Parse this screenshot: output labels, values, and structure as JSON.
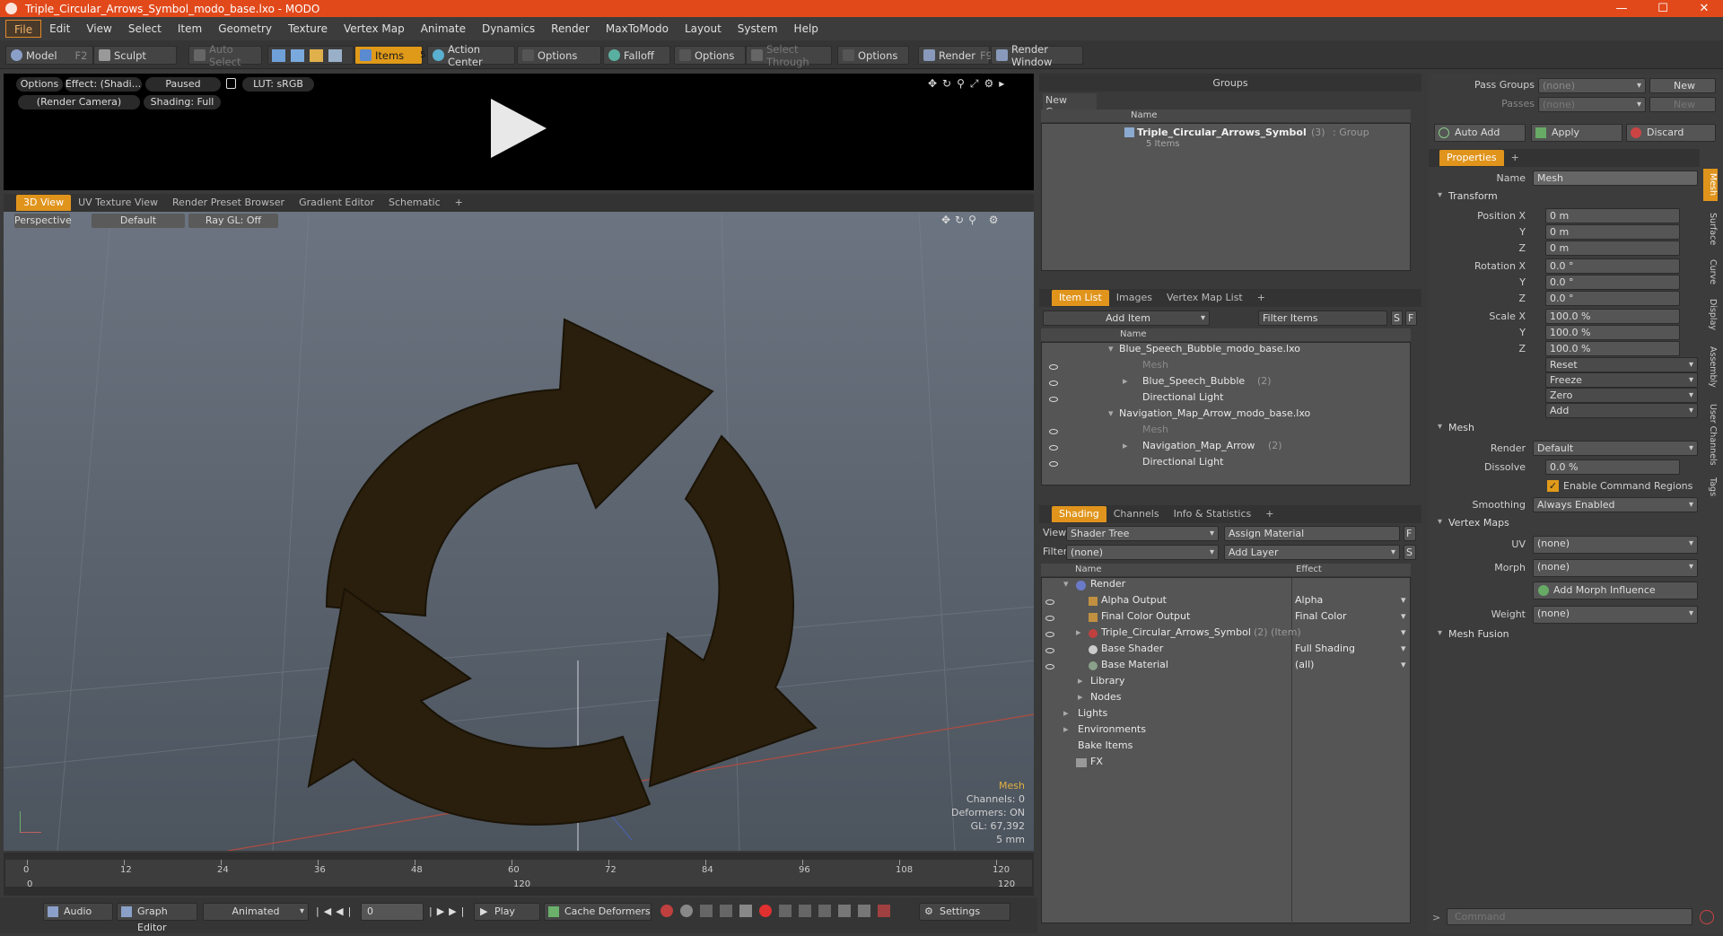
{
  "window": {
    "title": "Triple_Circular_Arrows_Symbol_modo_base.lxo - MODO"
  },
  "menu": [
    "File",
    "Edit",
    "View",
    "Select",
    "Item",
    "Geometry",
    "Texture",
    "Vertex Map",
    "Animate",
    "Dynamics",
    "Render",
    "MaxToModo",
    "Layout",
    "System",
    "Help"
  ],
  "toolbar": {
    "model": "Model",
    "model_key": "F2",
    "sculpt": "Sculpt",
    "auto_select": "Auto Select",
    "items": "Items",
    "items_key": "5",
    "action_center": "Action Center",
    "options1": "Options",
    "falloff": "Falloff",
    "options2": "Options",
    "select_through": "Select Through",
    "options3": "Options",
    "render": "Render",
    "render_key": "F9",
    "render_window": "Render Window"
  },
  "preview": {
    "options": "Options",
    "effect": "Effect: (Shadi...",
    "paused": "Paused",
    "lut": "LUT: sRGB",
    "camera": "(Render Camera)",
    "shading": "Shading: Full"
  },
  "viewport_tabs": [
    "3D View",
    "UV Texture View",
    "Render Preset Browser",
    "Gradient Editor",
    "Schematic"
  ],
  "viewport": {
    "perspective": "Perspective",
    "default": "Default",
    "raygl": "Ray GL: Off",
    "info_title": "Mesh",
    "channels": "Channels: 0",
    "deformers": "Deformers: ON",
    "gl": "GL: 67,392",
    "unit": "5 mm"
  },
  "timeline": {
    "ticks": [
      "0",
      "12",
      "24",
      "36",
      "48",
      "60",
      "72",
      "84",
      "96",
      "108",
      "120"
    ],
    "sub_left": "0",
    "sub_mid": "120",
    "sub_right": "120"
  },
  "bottom": {
    "audio": "Audio",
    "graph_editor": "Graph Editor",
    "animated": "Animated",
    "frame": "0",
    "play": "Play",
    "cache": "Cache Deformers",
    "settings": "Settings"
  },
  "groups": {
    "title": "Groups",
    "new_group": "New Group",
    "col_name": "Name",
    "item_name": "Triple_Circular_Arrows_Symbol",
    "item_count": "(3)",
    "item_type": ": Group",
    "item_sub": "5 Items"
  },
  "itemlist": {
    "tabs": [
      "Item List",
      "Images",
      "Vertex Map List"
    ],
    "add_item": "Add Item",
    "filter": "Filter Items",
    "s": "S",
    "f": "F",
    "col_name": "Name",
    "rows": [
      {
        "label": "Blue_Speech_Bubble_modo_base.lxo",
        "extra": ""
      },
      {
        "label": "Mesh",
        "extra": ""
      },
      {
        "label": "Blue_Speech_Bubble",
        "extra": "(2)"
      },
      {
        "label": "Directional Light",
        "extra": ""
      },
      {
        "label": "Navigation_Map_Arrow_modo_base.lxo",
        "extra": ""
      },
      {
        "label": "Mesh",
        "extra": ""
      },
      {
        "label": "Navigation_Map_Arrow",
        "extra": "(2)"
      },
      {
        "label": "Directional Light",
        "extra": ""
      }
    ]
  },
  "shading": {
    "tabs": [
      "Shading",
      "Channels",
      "Info & Statistics"
    ],
    "view_label": "View",
    "view_value": "Shader Tree",
    "assign": "Assign Material",
    "f": "F",
    "filter_label": "Filter",
    "filter_value": "(none)",
    "add_layer": "Add Layer",
    "s": "S",
    "col_name": "Name",
    "col_effect": "Effect",
    "rows": [
      {
        "label": "Render",
        "effect": "",
        "extra": ""
      },
      {
        "label": "Alpha Output",
        "effect": "Alpha",
        "extra": ""
      },
      {
        "label": "Final Color Output",
        "effect": "Final Color",
        "extra": ""
      },
      {
        "label": "Triple_Circular_Arrows_Symbol",
        "effect": "",
        "extra": "(2) (Item)"
      },
      {
        "label": "Base Shader",
        "effect": "Full Shading",
        "extra": ""
      },
      {
        "label": "Base Material",
        "effect": "(all)",
        "extra": ""
      },
      {
        "label": "Library",
        "effect": "",
        "extra": ""
      },
      {
        "label": "Nodes",
        "effect": "",
        "extra": ""
      },
      {
        "label": "Lights",
        "effect": "",
        "extra": ""
      },
      {
        "label": "Environments",
        "effect": "",
        "extra": ""
      },
      {
        "label": "Bake Items",
        "effect": "",
        "extra": ""
      },
      {
        "label": "FX",
        "effect": "",
        "extra": ""
      }
    ]
  },
  "passes": {
    "pass_groups": "Pass Groups",
    "pass_value": "(none)",
    "new": "New",
    "passes": "Passes",
    "passes_value": "(none)",
    "new2": "New",
    "auto_add": "Auto Add",
    "apply": "Apply",
    "discard": "Discard"
  },
  "properties": {
    "tab": "Properties",
    "name_label": "Name",
    "name_value": "Mesh",
    "transform": "Transform",
    "pos_x_label": "Position X",
    "y": "Y",
    "z": "Z",
    "pos": [
      "0 m",
      "0 m",
      "0 m"
    ],
    "rot_x_label": "Rotation X",
    "rot": [
      "0.0 °",
      "0.0 °",
      "0.0 °"
    ],
    "scale_x_label": "Scale X",
    "scale": [
      "100.0 %",
      "100.0 %",
      "100.0 %"
    ],
    "reset": "Reset",
    "freeze": "Freeze",
    "zero": "Zero",
    "add": "Add",
    "mesh": "Mesh",
    "render_label": "Render",
    "render_value": "Default",
    "dissolve_label": "Dissolve",
    "dissolve_value": "0.0 %",
    "enable_cmd": "Enable Command Regions",
    "smoothing_label": "Smoothing",
    "smoothing_value": "Always Enabled",
    "vertex_maps": "Vertex Maps",
    "uv_label": "UV",
    "uv_value": "(none)",
    "morph_label": "Morph",
    "morph_value": "(none)",
    "add_morph": "Add Morph Influence",
    "weight_label": "Weight",
    "weight_value": "(none)",
    "mesh_fusion": "Mesh Fusion",
    "side_tabs": [
      "Mesh",
      "Surface",
      "Curve",
      "Display",
      "Assembly",
      "User Channels",
      "Tags"
    ]
  },
  "command": {
    "placeholder": "Command"
  }
}
